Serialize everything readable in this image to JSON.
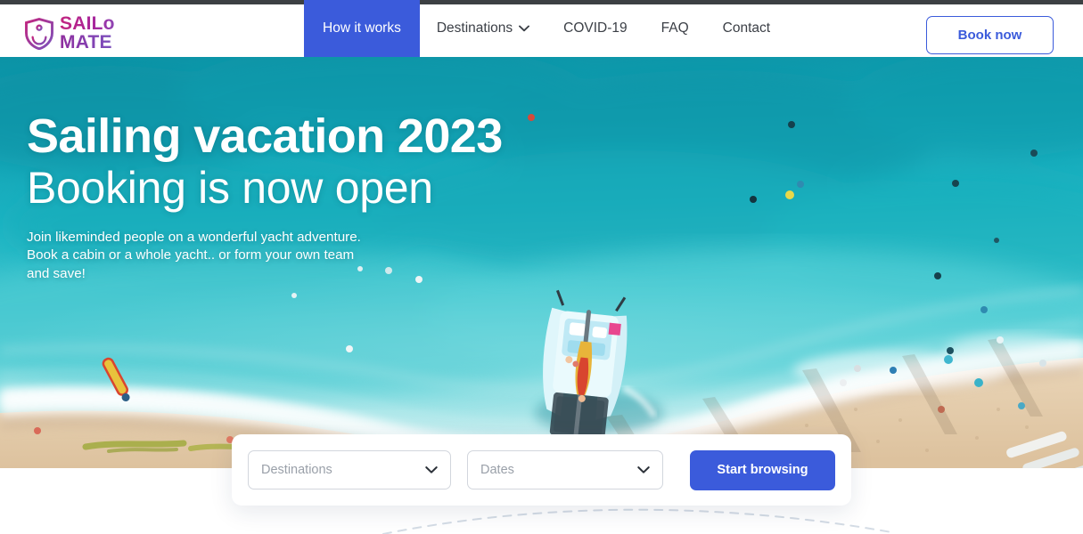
{
  "brand": {
    "logo_line1": "SAILo",
    "logo_line2": "MATE",
    "logo_icon": "shield-anchor-icon",
    "gradient_start": "#c2257f",
    "gradient_end": "#7a52bd"
  },
  "nav": {
    "items": [
      {
        "label": "How it works",
        "active": true,
        "has_chevron": false
      },
      {
        "label": "Destinations",
        "active": false,
        "has_chevron": true
      },
      {
        "label": "COVID-19",
        "active": false,
        "has_chevron": false
      },
      {
        "label": "FAQ",
        "active": false,
        "has_chevron": false
      },
      {
        "label": "Contact",
        "active": false,
        "has_chevron": false
      }
    ],
    "active_bg": "#3b5bdb",
    "text_color": "#3b3f46"
  },
  "header": {
    "book_now_label": "Book now",
    "accent": "#3b5bdb"
  },
  "hero": {
    "heading_bold": "Sailing vacation 2023",
    "heading_light": "Booking is now open",
    "subtitle": "Join likeminded people on a wonderful yacht adventure. Book a cabin or a whole yacht.. or form your own team and save!",
    "image_description": "aerial-beach-catamaran-photo",
    "ocean_color": "#15a7b8",
    "sand_color": "#e8cfae"
  },
  "search": {
    "destinations_placeholder": "Destinations",
    "dates_placeholder": "Dates",
    "submit_label": "Start browsing",
    "submit_color": "#3b5bdb"
  }
}
